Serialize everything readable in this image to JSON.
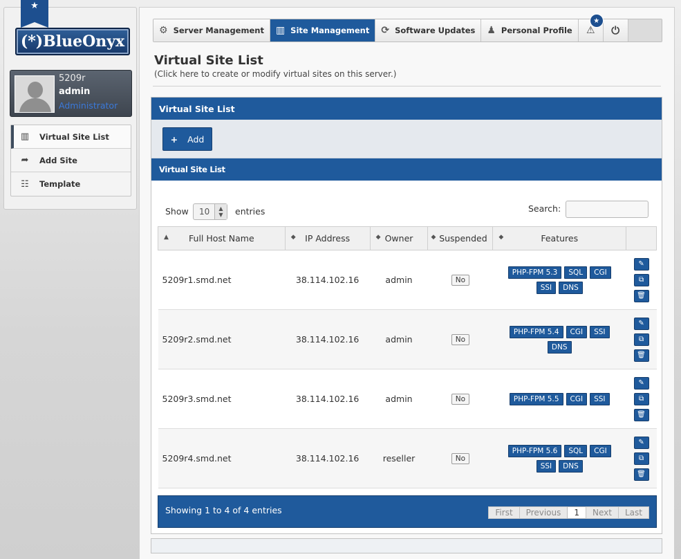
{
  "brand": {
    "logo_text": "(*)BlueOnyx"
  },
  "user": {
    "server": "5209r",
    "name": "admin",
    "role": "Administrator"
  },
  "sidebar": {
    "items": [
      {
        "label": "Virtual Site List",
        "icon": "layout-icon",
        "active": true
      },
      {
        "label": "Add Site",
        "icon": "share-arrow-icon",
        "active": false
      },
      {
        "label": "Template",
        "icon": "sliders-icon",
        "active": false
      }
    ]
  },
  "nav": {
    "tabs": [
      {
        "label": "Server Management",
        "icon": "gear-icon"
      },
      {
        "label": "Site Management",
        "icon": "layout-icon",
        "active": true
      },
      {
        "label": "Software Updates",
        "icon": "refresh-icon"
      },
      {
        "label": "Personal Profile",
        "icon": "person-icon"
      }
    ],
    "alert_badge": "★"
  },
  "page": {
    "title": "Virtual Site List",
    "subtitle": "(Click here to create or modify virtual sites on this server.)"
  },
  "panel": {
    "title": "Virtual Site List",
    "add_label": "Add",
    "subtitle": "Virtual Site List"
  },
  "table": {
    "show_label": "Show",
    "length": "10",
    "entries_label": "entries",
    "search_label": "Search:",
    "search_value": "",
    "headers": [
      "Full Host Name",
      "IP Address",
      "Owner",
      "Suspended",
      "Features"
    ],
    "rows": [
      {
        "host": "5209r1.smd.net",
        "ip": "38.114.102.16",
        "owner": "admin",
        "suspended": "No",
        "features": [
          "PHP-FPM 5.3",
          "SQL",
          "CGI",
          "SSI",
          "DNS"
        ]
      },
      {
        "host": "5209r2.smd.net",
        "ip": "38.114.102.16",
        "owner": "admin",
        "suspended": "No",
        "features": [
          "PHP-FPM 5.4",
          "CGI",
          "SSI",
          "DNS"
        ]
      },
      {
        "host": "5209r3.smd.net",
        "ip": "38.114.102.16",
        "owner": "admin",
        "suspended": "No",
        "features": [
          "PHP-FPM 5.5",
          "CGI",
          "SSI"
        ]
      },
      {
        "host": "5209r4.smd.net",
        "ip": "38.114.102.16",
        "owner": "reseller",
        "suspended": "No",
        "features": [
          "PHP-FPM 5.6",
          "SQL",
          "CGI",
          "SSI",
          "DNS"
        ]
      }
    ],
    "info": "Showing 1 to 4 of 4 entries",
    "pager": {
      "first": "First",
      "previous": "Previous",
      "current": "1",
      "next": "Next",
      "last": "Last"
    }
  },
  "colors": {
    "accent": "#1f5a9c",
    "link": "#3b79d9"
  }
}
